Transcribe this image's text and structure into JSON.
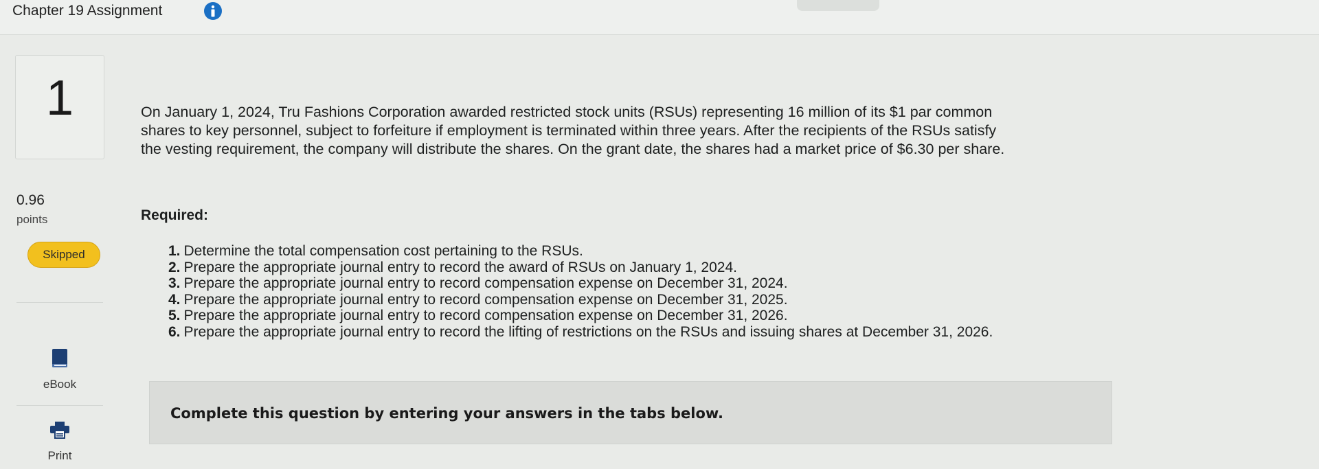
{
  "header": {
    "title": "Chapter 19 Assignment",
    "info_icon": "info-circle-icon",
    "accent_color": "#1a6fc4"
  },
  "sidebar": {
    "question_number": "1",
    "points_value": "0.96",
    "points_label": "points",
    "status_badge": "Skipped",
    "status_color": "#f2c01e",
    "tools": [
      {
        "label": "eBook",
        "icon": "book-icon"
      },
      {
        "label": "Print",
        "icon": "printer-icon"
      }
    ]
  },
  "question": {
    "intro_lines": [
      "On January 1, 2024, Tru Fashions Corporation awarded restricted stock units (RSUs) representing 16 million of its $1 par common",
      "shares to key personnel, subject to forfeiture if employment is terminated within three years. After the recipients of the RSUs satisfy",
      "the vesting requirement, the company will distribute the shares. On the grant date, the shares had a market price of $6.30 per share."
    ],
    "required_heading": "Required:",
    "steps": [
      {
        "num": "1.",
        "text": "Determine the total compensation cost pertaining to the RSUs."
      },
      {
        "num": "2.",
        "text": "Prepare the appropriate journal entry to record the award of RSUs on January 1, 2024."
      },
      {
        "num": "3.",
        "text": "Prepare the appropriate journal entry to record compensation expense on December 31, 2024."
      },
      {
        "num": "4.",
        "text": "Prepare the appropriate journal entry to record compensation expense on December 31, 2025."
      },
      {
        "num": "5.",
        "text": "Prepare the appropriate journal entry to record compensation expense on December 31, 2026."
      },
      {
        "num": "6.",
        "text": "Prepare the appropriate journal entry to record the lifting of restrictions on the RSUs and issuing shares at December 31, 2026."
      }
    ],
    "answers_prompt": "Complete this question by entering your answers in the tabs below."
  }
}
